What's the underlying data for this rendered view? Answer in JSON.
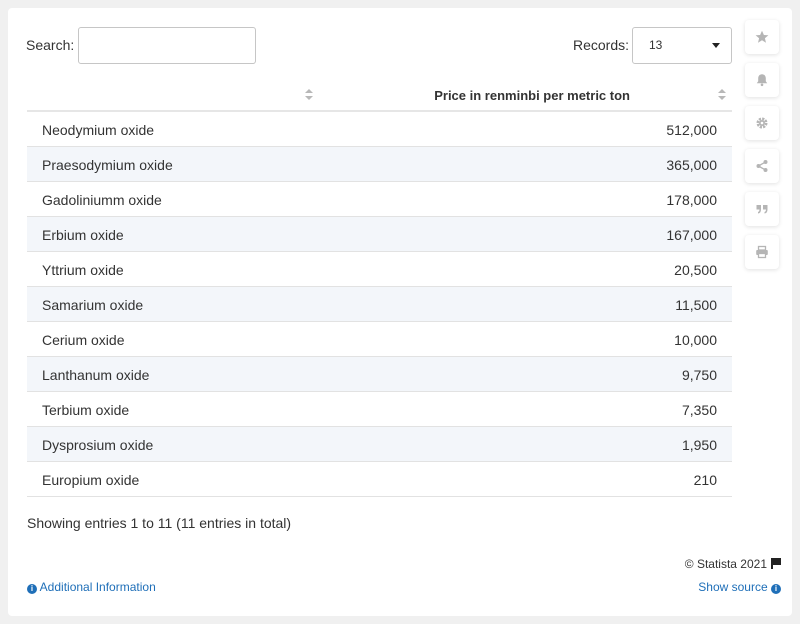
{
  "controls": {
    "search_label": "Search:",
    "search_value": "",
    "records_label": "Records:",
    "records_value": "13"
  },
  "table": {
    "columns": [
      "",
      "Price in renminbi per metric ton"
    ],
    "rows": [
      {
        "name": "Neodymium oxide",
        "value": "512,000"
      },
      {
        "name": "Praesodymium oxide",
        "value": "365,000"
      },
      {
        "name": "Gadoliniumm oxide",
        "value": "178,000"
      },
      {
        "name": "Erbium oxide",
        "value": "167,000"
      },
      {
        "name": "Yttrium oxide",
        "value": "20,500"
      },
      {
        "name": "Samarium oxide",
        "value": "11,500"
      },
      {
        "name": "Cerium oxide",
        "value": "10,000"
      },
      {
        "name": "Lanthanum oxide",
        "value": "9,750"
      },
      {
        "name": "Terbium oxide",
        "value": "7,350"
      },
      {
        "name": "Dysprosium oxide",
        "value": "1,950"
      },
      {
        "name": "Europium oxide",
        "value": "210"
      }
    ]
  },
  "footer": {
    "entries_text": "Showing entries 1 to 11 (11 entries in total)",
    "copyright": "© Statista 2021",
    "additional_info": "Additional Information",
    "show_source": "Show source"
  },
  "sidebar": {
    "icons": [
      "star-icon",
      "bell-icon",
      "gear-icon",
      "share-icon",
      "quote-icon",
      "print-icon"
    ]
  },
  "colors": {
    "link": "#1f6fb8",
    "row_stripe": "#f3f6fa",
    "icon_gray": "#b5b5b5"
  }
}
